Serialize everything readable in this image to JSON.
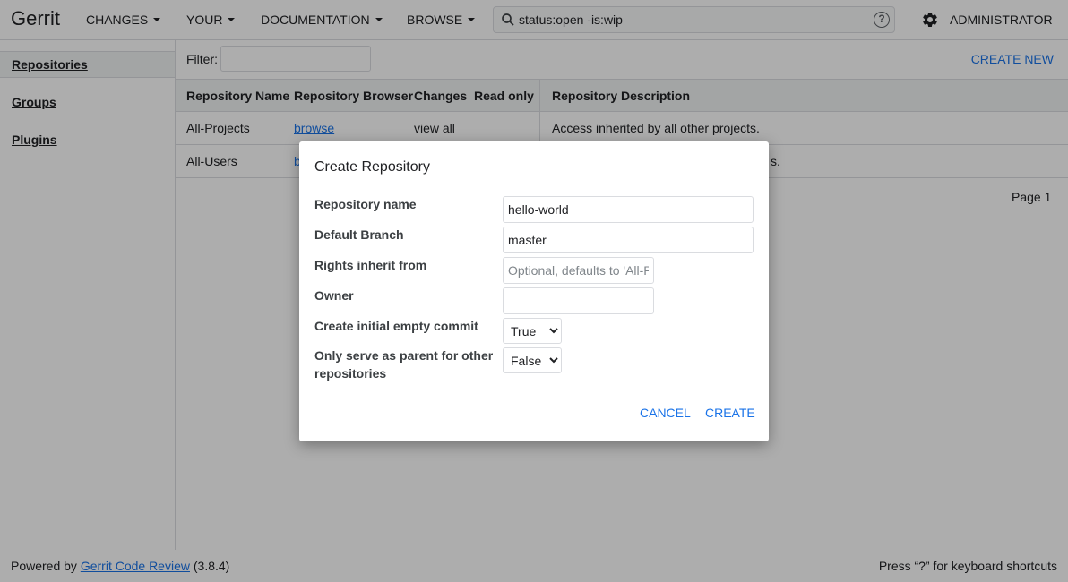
{
  "header": {
    "logo": "Gerrit",
    "nav": [
      "CHANGES",
      "YOUR",
      "DOCUMENTATION",
      "BROWSE"
    ],
    "search_value": "status:open -is:wip",
    "help": "?",
    "user": "ADMINISTRATOR"
  },
  "sidebar": {
    "items": [
      {
        "label": "Repositories",
        "selected": true
      },
      {
        "label": "Groups",
        "selected": false
      },
      {
        "label": "Plugins",
        "selected": false
      }
    ]
  },
  "filter": {
    "label": "Filter:",
    "value": "",
    "create_new": "CREATE NEW"
  },
  "table": {
    "headers": [
      "Repository Name",
      "Repository Browser",
      "Changes",
      "Read only",
      "Repository Description"
    ],
    "rows": [
      {
        "name": "All-Projects",
        "browser": "browse",
        "changes": "view all",
        "read_only": "",
        "description": "Access inherited by all other projects."
      },
      {
        "name": "All-Users",
        "browser": "b",
        "changes": "",
        "read_only": "",
        "description": "s."
      }
    ],
    "page": "Page 1"
  },
  "footer": {
    "powered_by": "Powered by",
    "link": "Gerrit Code Review",
    "version": "(3.8.4)",
    "shortcut_hint": "Press “?” for keyboard shortcuts"
  },
  "dialog": {
    "title": "Create Repository",
    "fields": {
      "repo_name_label": "Repository name",
      "repo_name_value": "hello-world",
      "default_branch_label": "Default Branch",
      "default_branch_value": "master",
      "rights_label": "Rights inherit from",
      "rights_placeholder": "Optional, defaults to 'All-Projects'",
      "owner_label": "Owner",
      "owner_value": "",
      "initial_commit_label": "Create initial empty commit",
      "initial_commit_value": "True",
      "parent_only_label": "Only serve as parent for other repositories",
      "parent_only_value": "False"
    },
    "cancel": "CANCEL",
    "create": "CREATE"
  },
  "colors": {
    "accent": "#1a73e8",
    "overlay": "rgba(0,0,0,0.32)"
  }
}
